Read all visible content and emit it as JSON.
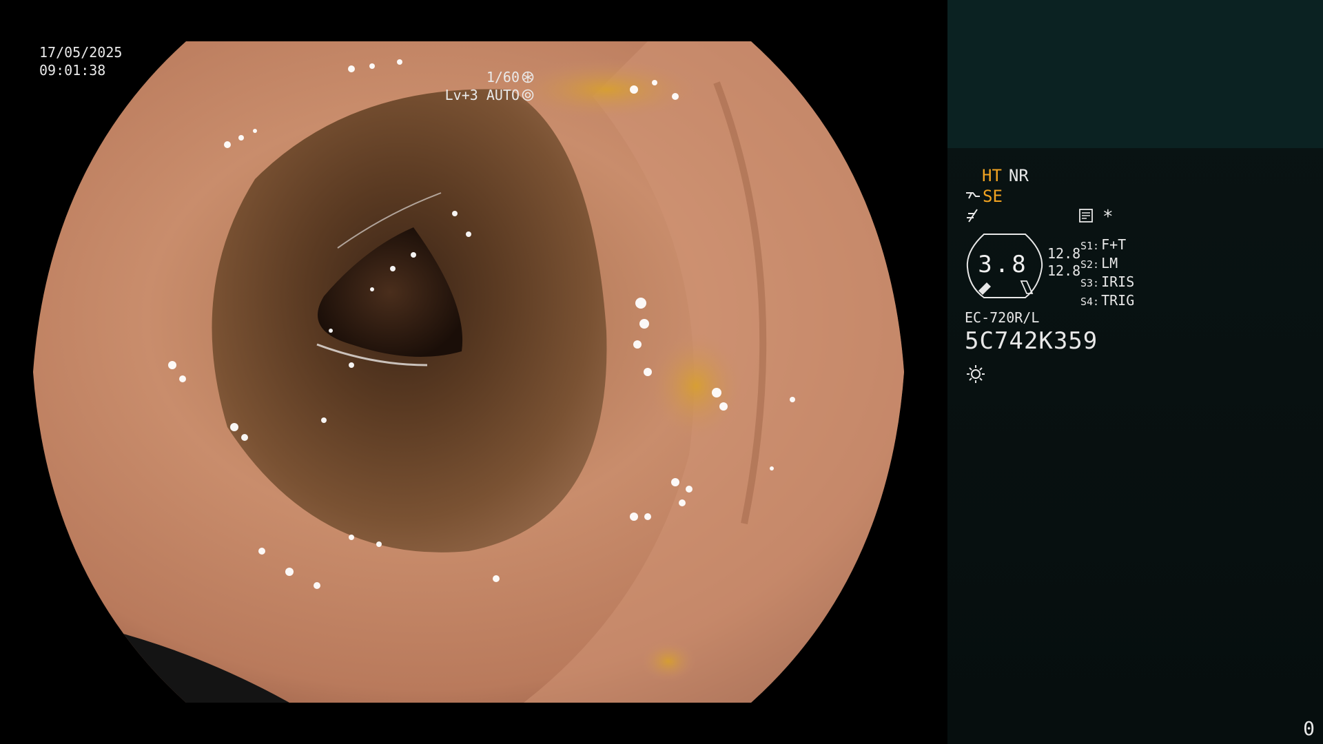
{
  "overlay": {
    "date": "17/05/2025",
    "time": "09:01:38",
    "shutter_speed": "1/60",
    "exposure": "Lv+3 AUTO"
  },
  "panel": {
    "mode_ht": "HT",
    "mode_nr": "NR",
    "mode_se": "SE",
    "asterisk": "*",
    "gauge_value": "3.8",
    "gauge_num_1": "12.8",
    "gauge_num_2": "12.8",
    "switches": [
      {
        "prefix": "S1:",
        "label": "F+T"
      },
      {
        "prefix": "S2:",
        "label": "LM"
      },
      {
        "prefix": "S3:",
        "label": "IRIS"
      },
      {
        "prefix": "S4:",
        "label": "TRIG"
      }
    ],
    "scope_model": "EC-720R/L",
    "scope_serial": "5C742K359",
    "counter": "0"
  },
  "colors": {
    "accent_orange": "#f2a321",
    "panel_bg": "#060e0e",
    "panel_top_bg": "#0b2222"
  },
  "icons": [
    "shutter-icon",
    "iris-icon",
    "scope-tip-icon",
    "freeze-icon",
    "memory-icon",
    "light-icon"
  ]
}
